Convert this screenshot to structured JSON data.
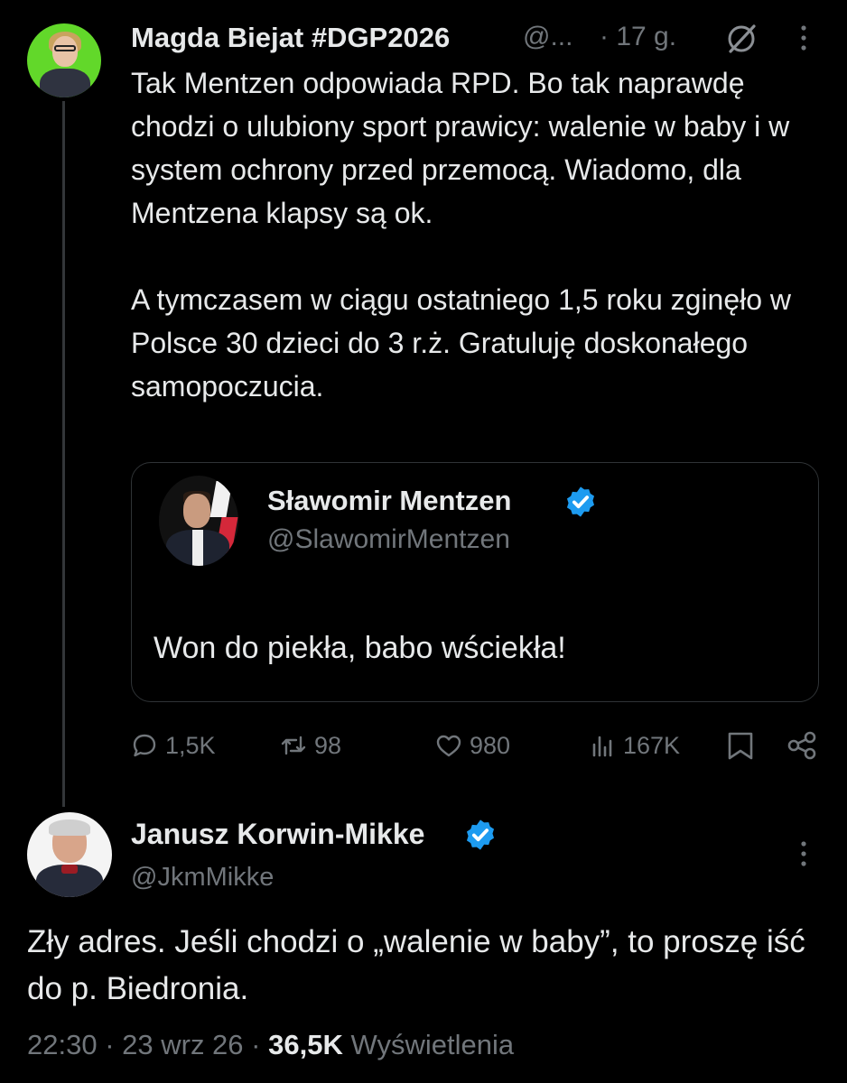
{
  "tweet": {
    "author_name": "Magda Biejat #DGP2026",
    "handle": "@...",
    "time": "· 17 g.",
    "text_paragraphs": [
      "Tak Mentzen odpowiada RPD. Bo tak naprawdę chodzi o ulubiony sport prawicy: walenie w baby i w system ochrony przed przemocą. Wiadomo, dla Mentzena klapsy są ok.",
      "A tymczasem w ciągu ostatniego 1,5 roku zginęło w Polsce 30 dzieci do 3 r.ż. Gratuluję doskonałego samopoczucia."
    ],
    "quote": {
      "author_name": "Sławomir Mentzen",
      "handle": "@SlawomirMentzen",
      "text": "Won do piekła, babo wściekła!"
    },
    "actions": {
      "replies": "1,5K",
      "reposts": "98",
      "likes": "980",
      "views": "167K"
    }
  },
  "reply": {
    "author_name": "Janusz Korwin-Mikke",
    "handle": "@JkmMikke",
    "text": "Zły adres. Jeśli chodzi o „walenie w baby”, to proszę iść do p. Biedronia.",
    "time": "22:30",
    "date": "23 wrz 26",
    "views_count": "36,5K",
    "views_label": "Wyświetlenia"
  },
  "colors": {
    "background": "#000000",
    "text": "#e7e9ea",
    "muted": "#71767b",
    "verified": "#1d9bf0"
  },
  "icons": [
    "grok-icon",
    "more-icon",
    "verified-badge-icon",
    "reply-icon",
    "repost-icon",
    "like-icon",
    "views-icon",
    "bookmark-icon",
    "share-icon"
  ]
}
